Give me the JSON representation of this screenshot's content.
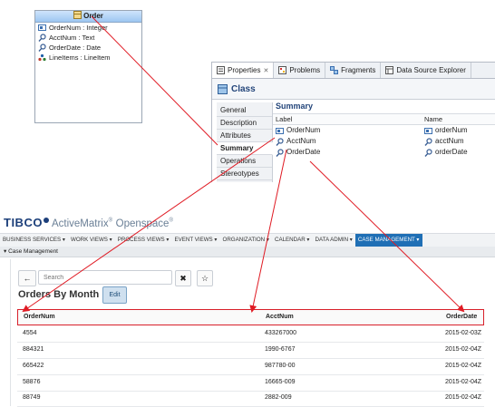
{
  "uml": {
    "class_name": "Order",
    "attributes": [
      {
        "label": "OrderNum : Integer",
        "icon": "id-attribute-icon"
      },
      {
        "label": "AcctNum : Text",
        "icon": "search-attribute-icon"
      },
      {
        "label": "OrderDate : Date",
        "icon": "search-attribute-icon"
      },
      {
        "label": "LineItems : LineItem",
        "icon": "association-icon"
      }
    ]
  },
  "properties_panel": {
    "tabs": [
      {
        "label": "Properties",
        "icon": "properties-icon"
      },
      {
        "label": "Problems",
        "icon": "problems-icon"
      },
      {
        "label": "Fragments",
        "icon": "fragments-icon"
      },
      {
        "label": "Data Source Explorer",
        "icon": "data-source-icon"
      }
    ],
    "close_glyph": "✕",
    "header": "Class",
    "sections": [
      "General",
      "Description",
      "Attributes",
      "Summary",
      "Operations",
      "Stereotypes"
    ],
    "active_section": "Summary",
    "summary_title": "Summary",
    "columns": {
      "label": "Label",
      "name": "Name"
    },
    "rows": [
      {
        "label": "OrderNum",
        "name": "orderNum"
      },
      {
        "label": "AcctNum",
        "name": "acctNum"
      },
      {
        "label": "OrderDate",
        "name": "orderDate"
      }
    ]
  },
  "app": {
    "logo": "TIBCO",
    "product": "ActiveMatrix",
    "product_suffix": "Openspace",
    "nav": [
      {
        "label": "BUSINESS SERVICES ▾"
      },
      {
        "label": "WORK VIEWS ▾"
      },
      {
        "label": "PROCESS VIEWS ▾"
      },
      {
        "label": "EVENT VIEWS ▾"
      },
      {
        "label": "ORGANIZATION ▾"
      },
      {
        "label": "CALENDAR ▾"
      },
      {
        "label": "DATA ADMIN ▾"
      },
      {
        "label": "CASE MANAGEMENT ▾",
        "active": true
      }
    ],
    "breadcrumb": "▾ Case Management",
    "search_placeholder": "Search",
    "back_glyph": "←",
    "clear_glyph": "✖",
    "star_glyph": "☆",
    "title": "Orders By Month",
    "edit_label": "Edit",
    "grid": {
      "columns": [
        "OrderNum",
        "AcctNum",
        "OrderDate"
      ],
      "rows": [
        [
          "4554",
          "433267000",
          "2015-02-03Z"
        ],
        [
          "884321",
          "1990-6767",
          "2015-02-04Z"
        ],
        [
          "665422",
          "987780-00",
          "2015-02-04Z"
        ],
        [
          "58876",
          "16665-009",
          "2015-02-04Z"
        ],
        [
          "88749",
          "2882-009",
          "2015-02-04Z"
        ]
      ]
    }
  },
  "colors": {
    "arrow": "#e01b24",
    "accent": "#1f6fb5"
  }
}
